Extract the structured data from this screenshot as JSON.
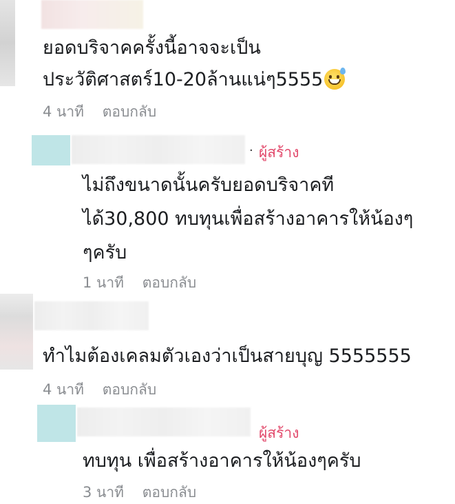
{
  "comments": [
    {
      "lines": [
        "ยอดบริจาคครั้งนี้อาจจะเป็น",
        "ประวัติศาสตร์10-20ล้านแน่ๆ5555"
      ],
      "emoji": "grinning-sweat-emoji",
      "time": "4 นาที",
      "reply": "ตอบกลับ"
    },
    {
      "creator_badge": "ผู้สร้าง",
      "lines": [
        "ไม่ถึงขนาดนั้นครับยอดบริจาคที",
        "ได้30,800 ทบทุนเพื่อสร้างอาคารให้น้องๆ",
        "ๆครับ"
      ],
      "time": "1 นาที",
      "reply": "ตอบกลับ"
    },
    {
      "lines": [
        "ทำไมต้องเคลมตัวเองว่าเป็นสายบุญ 5555555"
      ],
      "time": "4 นาที",
      "reply": "ตอบกลับ"
    },
    {
      "creator_badge": "ผู้สร้าง",
      "lines": [
        "ทบทุน เพื่อสร้างอาคารให้น้องๆครับ"
      ],
      "time": "3 นาที",
      "reply": "ตอบกลับ"
    }
  ],
  "colors": {
    "creator_badge": "#e2496b",
    "meta_text": "#8a8d91",
    "avatar_teal": "#bfe5e7",
    "avatar_pink": "#fbe8e8",
    "avatar_grey": "#dddddd"
  }
}
